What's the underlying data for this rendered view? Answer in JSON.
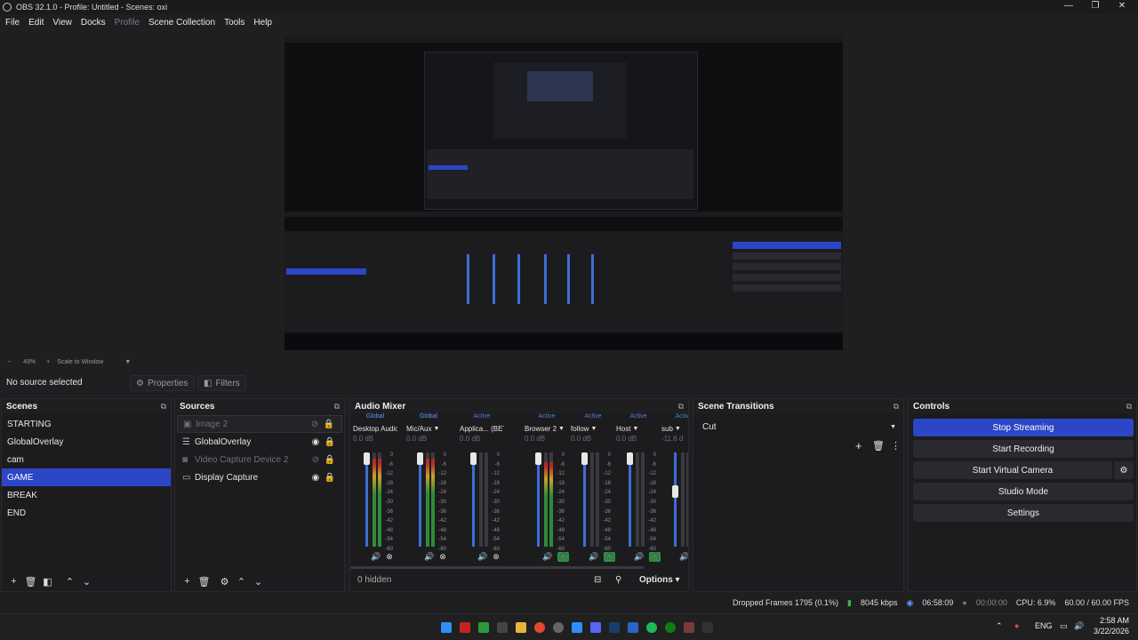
{
  "window": {
    "title": "OBS 32.1.0 - Profile: Untitled - Scenes: oxi",
    "minimize": "—",
    "maximize": "❐",
    "close": "✕"
  },
  "menu": [
    "File",
    "Edit",
    "View",
    "Docks",
    "Profile",
    "Scene Collection",
    "Tools",
    "Help"
  ],
  "zoom": {
    "level": "49%",
    "mode": "Scale to Window"
  },
  "context": {
    "status": "No source selected",
    "properties": "Properties",
    "filters": "Filters"
  },
  "scenes": {
    "title": "Scenes",
    "items": [
      "STARTING",
      "GlobalOverlay",
      "cam",
      "GAME",
      "BREAK",
      "END"
    ],
    "selected": "GAME"
  },
  "sources": {
    "title": "Sources",
    "items": [
      "Image 2",
      "GlobalOverlay",
      "Video Capture Device 2",
      "Display Capture"
    ]
  },
  "mixer": {
    "title": "Audio Mixer",
    "channels": [
      {
        "status": "Global",
        "name": "Desktop Audio",
        "db": "0.0 dB",
        "level": 0.93
      },
      {
        "status": "Global",
        "name": "Mic/Aux",
        "db": "0.0 dB",
        "level": 0.93
      },
      {
        "status": "Active",
        "name": "Applica... (BETA)",
        "db": "0.0 dB",
        "level": 0.0
      },
      {
        "status": "Active",
        "name": "Browser 2",
        "db": "0.0 dB",
        "level": 0.9
      },
      {
        "status": "Active",
        "name": "follow",
        "db": "0.0 dB",
        "level": 0.0
      },
      {
        "status": "Active",
        "name": "Host",
        "db": "0.0 dB",
        "level": 0.0
      },
      {
        "status": "Active",
        "name": "sub",
        "db": "-11.6 d",
        "level": 0.0
      }
    ],
    "scale": [
      "0",
      "-6",
      "-12",
      "-18",
      "-24",
      "-30",
      "-36",
      "-42",
      "-48",
      "-54",
      "-60"
    ],
    "hidden": "0 hidden",
    "options": "Options"
  },
  "transitions": {
    "title": "Scene Transitions",
    "selected": "Cut"
  },
  "controls": {
    "title": "Controls",
    "buttons": [
      "Stop Streaming",
      "Start Recording",
      "Start Virtual Camera",
      "Studio Mode",
      "Settings"
    ]
  },
  "status": {
    "dropped": "Dropped Frames 1795 (0.1%)",
    "kbps": "8045 kbps",
    "stream_time": "06:58:09",
    "rec_time": "00:00:00",
    "cpu": "CPU: 6.9%",
    "fps": "60.00 / 60.00 FPS"
  },
  "taskbar": {
    "lang": "ENG",
    "time": "2:58 AM",
    "date": "3/22/2026"
  },
  "colors": {
    "accent": "#2b46c6",
    "active": "#5a9bff",
    "monitor": "#1f9a3a",
    "mute": "#c23b3b"
  }
}
